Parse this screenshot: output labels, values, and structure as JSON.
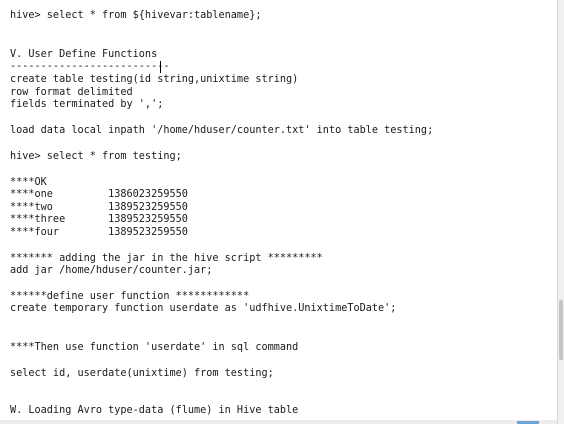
{
  "editor": {
    "lines": [
      "hive> select * from ${hivevar:tablename};",
      "V. User Define Functions",
      "--------------------------",
      "create table testing(id string,unixtime string)",
      "row format delimited",
      "fields terminated by ',';",
      "load data local inpath '/home/hduser/counter.txt' into table testing;",
      "hive> select * from testing;",
      "****OK",
      "****one         1386023259550",
      "****two         1389523259550",
      "****three       1389523259550",
      "****four        1389523259550",
      "******* adding the jar in the hive script *********",
      "add jar /home/hduser/counter.jar;",
      "******define user function ************",
      "create temporary function userdate as 'udfhive.UnixtimeToDate';",
      "****Then use function 'userdate' in sql command",
      "select id, userdate(unixtime) from testing;",
      "W. Loading Avro type-data (flume) in Hive table"
    ]
  }
}
